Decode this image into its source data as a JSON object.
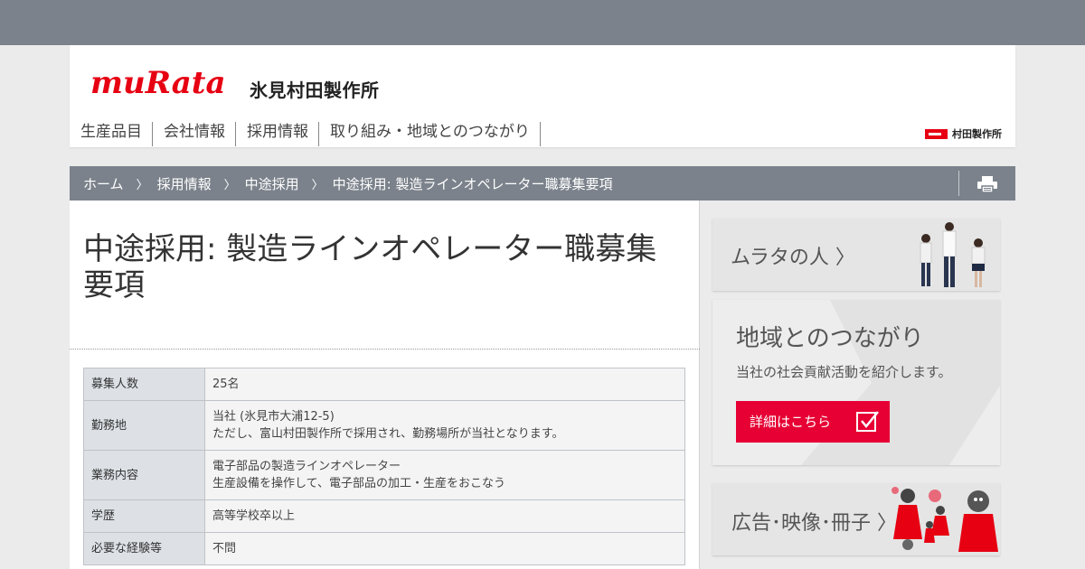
{
  "colors": {
    "brand_red": "#e60012",
    "bar_gray": "#7b828b",
    "button_red": "#e60034"
  },
  "header": {
    "logo_text": "muRata",
    "site_name": "氷見村田製作所",
    "nav": [
      "生産品目",
      "会社情報",
      "採用情報",
      "取り組み・地域とのつながり"
    ],
    "corp_link": "村田製作所"
  },
  "breadcrumb": {
    "items": [
      "ホーム",
      "採用情報",
      "中途採用",
      "中途採用: 製造ラインオペレーター職募集要項"
    ],
    "separator": "〉",
    "print_icon": "printer-icon"
  },
  "main": {
    "title": "中途採用: 製造ラインオペレーター職募集要項",
    "table": [
      {
        "label": "募集人数",
        "lines": [
          "25名"
        ]
      },
      {
        "label": "勤務地",
        "lines": [
          "当社 (氷見市大浦12-5)",
          "ただし、富山村田製作所で採用され、勤務場所が当社となります。"
        ]
      },
      {
        "label": "業務内容",
        "lines": [
          "電子部品の製造ラインオペレーター",
          "生産設備を操作して、電子部品の加工・生産をおこなう"
        ]
      },
      {
        "label": "学歴",
        "lines": [
          "高等学校卒以上"
        ]
      },
      {
        "label": "必要な経験等",
        "lines": [
          "不問"
        ]
      }
    ]
  },
  "sidebar": {
    "people_banner": {
      "label": "ムラタの人 〉"
    },
    "community_banner": {
      "title": "地域とのつながり",
      "description": "当社の社会貢献活動を紹介します。",
      "button_label": "詳細はこちら"
    },
    "ads_banner": {
      "label": "広告･映像･冊子 〉"
    }
  }
}
